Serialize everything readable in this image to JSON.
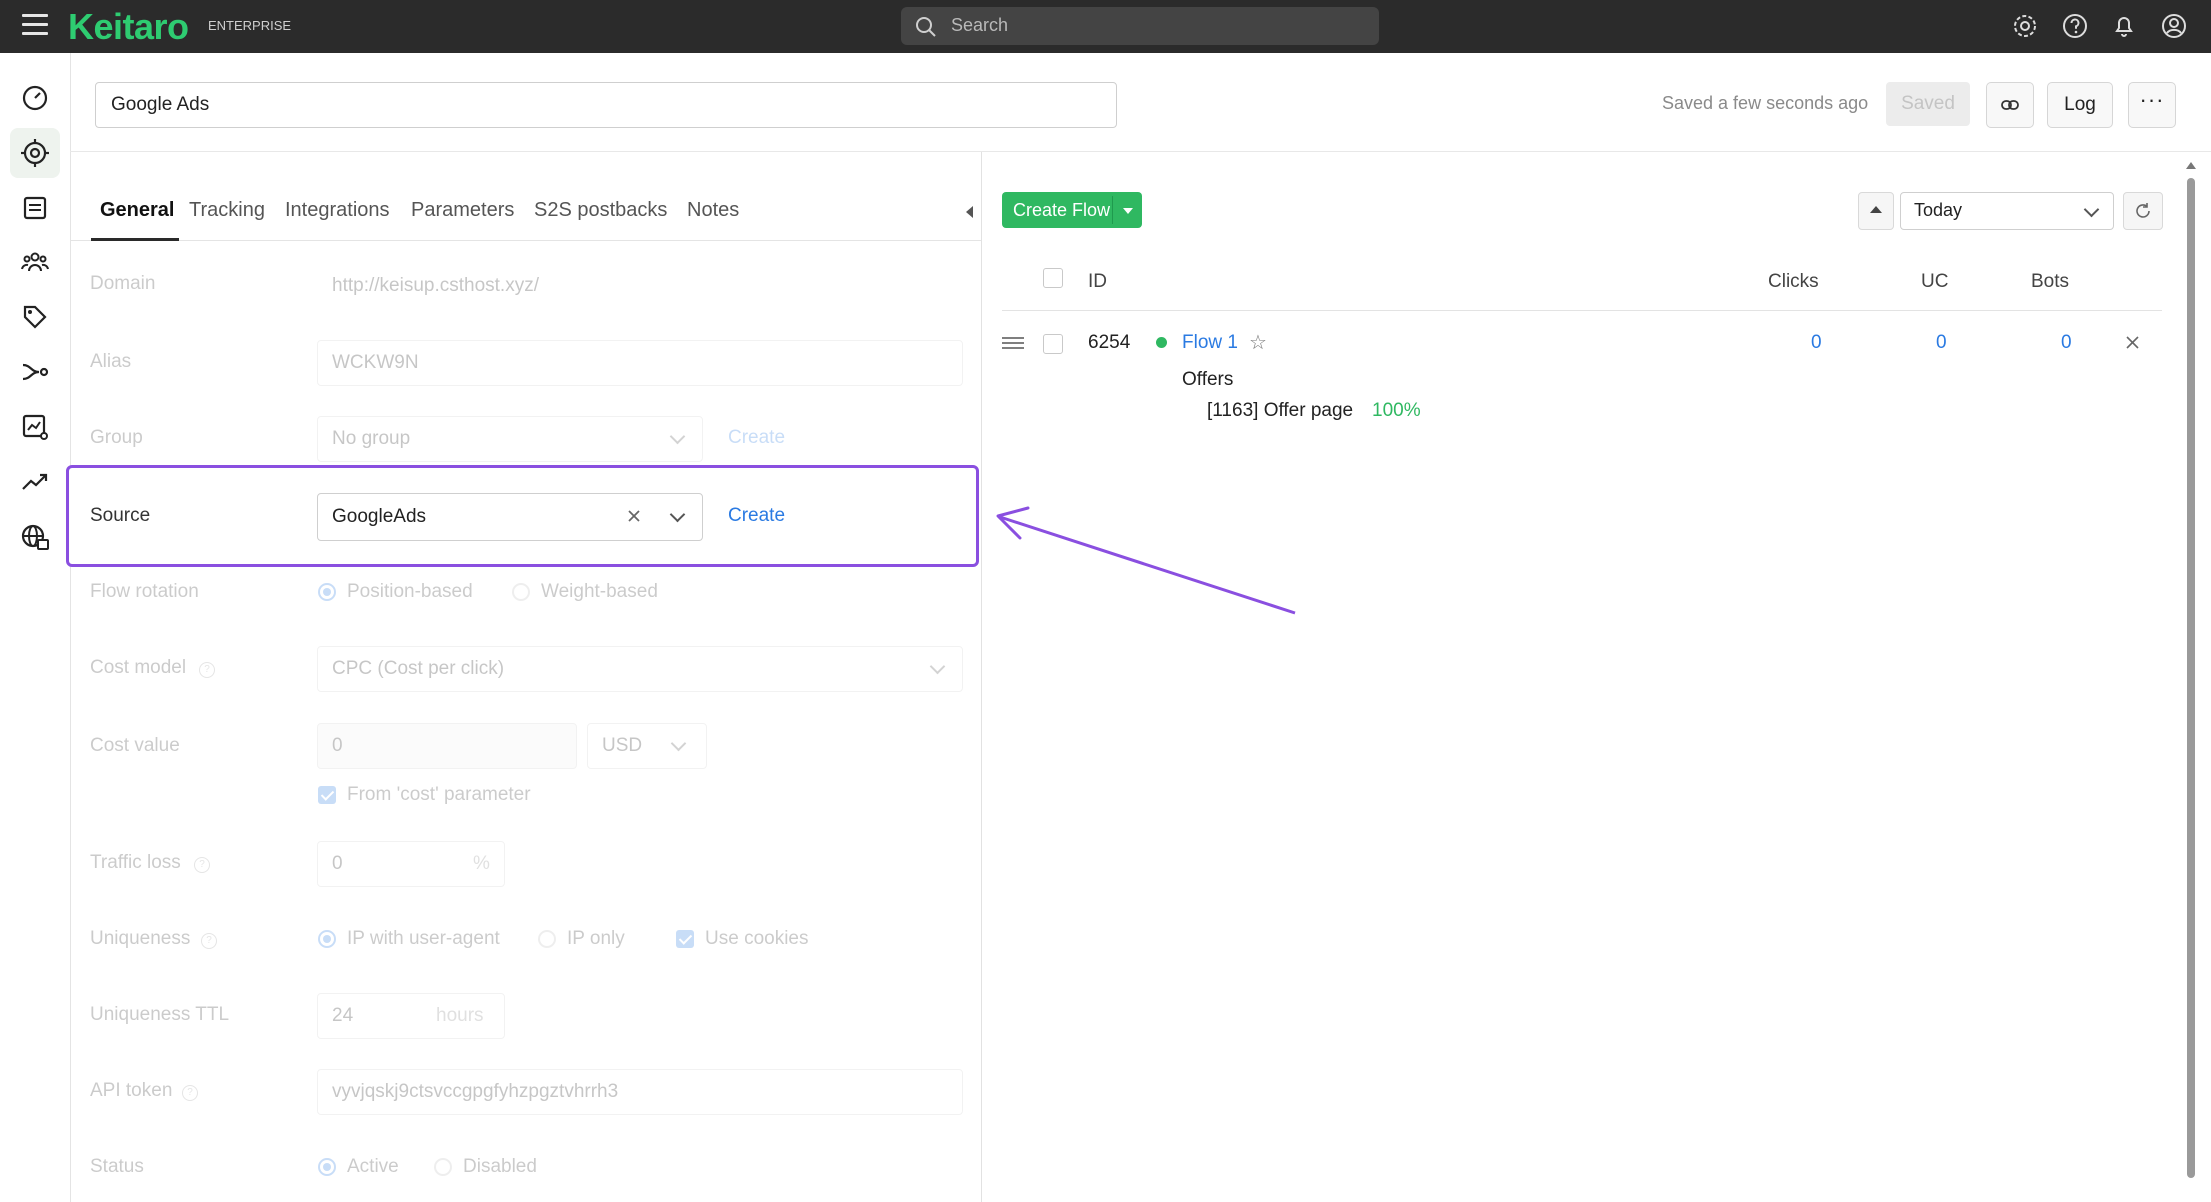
{
  "topbar": {
    "brand": "Keitaro",
    "edition": "ENTERPRISE",
    "search_placeholder": "Search",
    "icons": [
      "gear-icon",
      "help-icon",
      "bell-icon",
      "user-icon"
    ]
  },
  "sidebar": {
    "icons": [
      "dashboard-icon",
      "campaigns-icon",
      "offers-icon",
      "affiliate-networks-icon",
      "traffic-sources-icon",
      "flows-icon",
      "reports-icon",
      "trends-icon",
      "domains-icon"
    ],
    "selected": "campaigns-icon"
  },
  "header": {
    "campaign_name": "Google Ads",
    "saved_info": "Saved a few seconds ago",
    "saved_label": "Saved",
    "log_label": "Log"
  },
  "tabs": [
    {
      "label": "General",
      "active": true
    },
    {
      "label": "Tracking"
    },
    {
      "label": "Integrations"
    },
    {
      "label": "Parameters"
    },
    {
      "label": "S2S postbacks"
    },
    {
      "label": "Notes"
    }
  ],
  "form": {
    "domain": {
      "label": "Domain",
      "value": "http://keisup.csthost.xyz/"
    },
    "alias": {
      "label": "Alias",
      "value": "WCKW9N"
    },
    "group": {
      "label": "Group",
      "value": "No group",
      "link": "Create"
    },
    "source": {
      "label": "Source",
      "value": "GoogleAds",
      "link": "Create"
    },
    "flow_rotation": {
      "label": "Flow rotation",
      "options": [
        "Position-based",
        "Weight-based"
      ],
      "selected": "Position-based"
    },
    "cost_model": {
      "label": "Cost model",
      "value": "CPC (Cost per click)"
    },
    "cost_value": {
      "label": "Cost value",
      "value": "0",
      "currency": "USD",
      "checkbox_label": "From 'cost' parameter"
    },
    "traffic_loss": {
      "label": "Traffic loss",
      "value": "0",
      "unit": "%"
    },
    "uniqueness": {
      "label": "Uniqueness",
      "options": [
        "IP with user-agent",
        "IP only"
      ],
      "selected": "IP with user-agent",
      "checkbox_label": "Use cookies"
    },
    "uniqueness_ttl": {
      "label": "Uniqueness TTL",
      "value": "24",
      "unit": "hours"
    },
    "api_token": {
      "label": "API token",
      "value": "vyvjqskj9ctsvccgpgfyhzpgztvhrrh3"
    },
    "status": {
      "label": "Status",
      "options": [
        "Active",
        "Disabled"
      ],
      "selected": "Active"
    }
  },
  "flows": {
    "create_label": "Create Flow",
    "date_range": "Today",
    "columns": {
      "id": "ID",
      "clicks": "Clicks",
      "uc": "UC",
      "bots": "Bots"
    },
    "rows": [
      {
        "id": "6254",
        "name": "Flow 1",
        "status_color": "#2fb861",
        "clicks": "0",
        "uc": "0",
        "bots": "0",
        "offers_label": "Offers",
        "offer": "[1163] Offer page",
        "share": "100%"
      }
    ]
  },
  "colors": {
    "brand": "#2ecc71",
    "accent": "#2a7ae2",
    "highlight": "#8a4fe0",
    "create_button": "#2fb861"
  }
}
